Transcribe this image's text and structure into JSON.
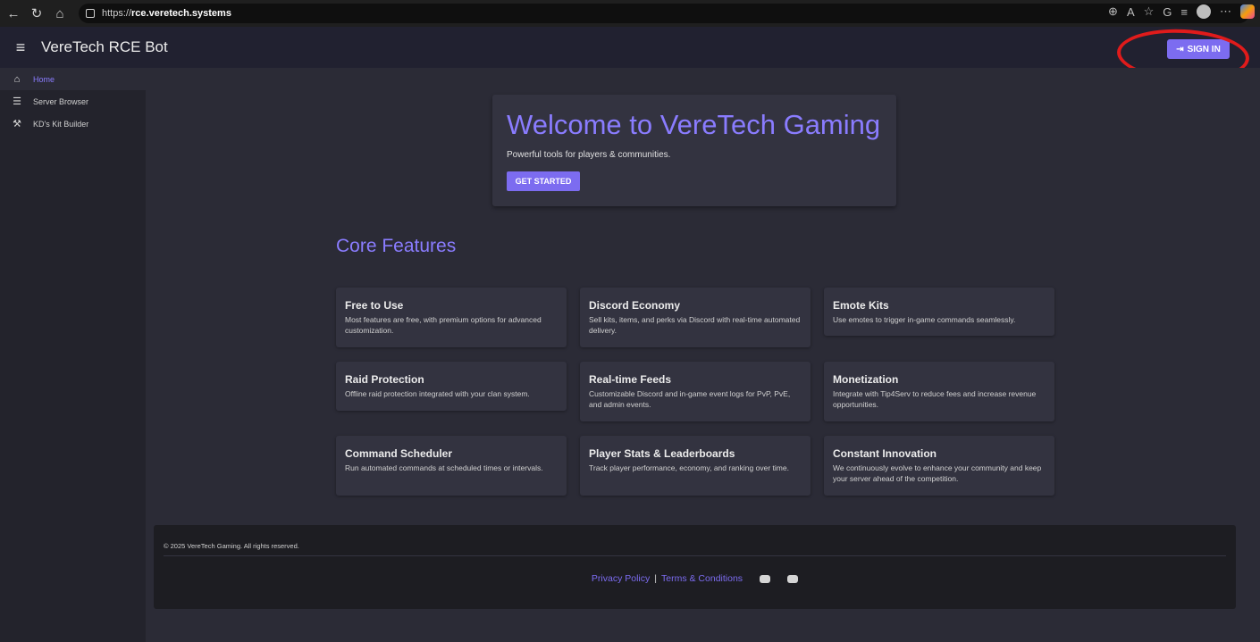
{
  "browser": {
    "url_protocol": "https://",
    "url_host": "rce.veretech.systems"
  },
  "header": {
    "title": "VereTech RCE Bot",
    "sign_in": "SIGN IN"
  },
  "sidebar": {
    "items": [
      {
        "label": "Home",
        "icon": "home-icon",
        "active": true
      },
      {
        "label": "Server Browser",
        "icon": "list-icon",
        "active": false
      },
      {
        "label": "KD's Kit Builder",
        "icon": "tools-icon",
        "active": false
      }
    ]
  },
  "hero": {
    "title": "Welcome to VereTech Gaming",
    "subtitle": "Powerful tools for players & communities.",
    "button": "GET STARTED"
  },
  "features": {
    "title": "Core Features",
    "cards": [
      {
        "title": "Free to Use",
        "desc": "Most features are free, with premium options for advanced customization."
      },
      {
        "title": "Discord Economy",
        "desc": "Sell kits, items, and perks via Discord with real-time automated delivery."
      },
      {
        "title": "Emote Kits",
        "desc": "Use emotes to trigger in-game commands seamlessly."
      },
      {
        "title": "Raid Protection",
        "desc": "Offline raid protection integrated with your clan system."
      },
      {
        "title": "Real-time Feeds",
        "desc": "Customizable Discord and in-game event logs for PvP, PvE, and admin events."
      },
      {
        "title": "Monetization",
        "desc": "Integrate with Tip4Serv to reduce fees and increase revenue opportunities."
      },
      {
        "title": "Command Scheduler",
        "desc": "Run automated commands at scheduled times or intervals."
      },
      {
        "title": "Player Stats & Leaderboards",
        "desc": "Track player performance, economy, and ranking over time."
      },
      {
        "title": "Constant Innovation",
        "desc": "We continuously evolve to enhance your community and keep your server ahead of the competition."
      }
    ]
  },
  "footer": {
    "copyright": "© 2025 VereTech Gaming. All rights reserved.",
    "privacy": "Privacy Policy",
    "separator": "|",
    "terms": "Terms & Conditions"
  },
  "colors": {
    "accent": "#7c6cf0",
    "annotation": "#e01b1b"
  }
}
